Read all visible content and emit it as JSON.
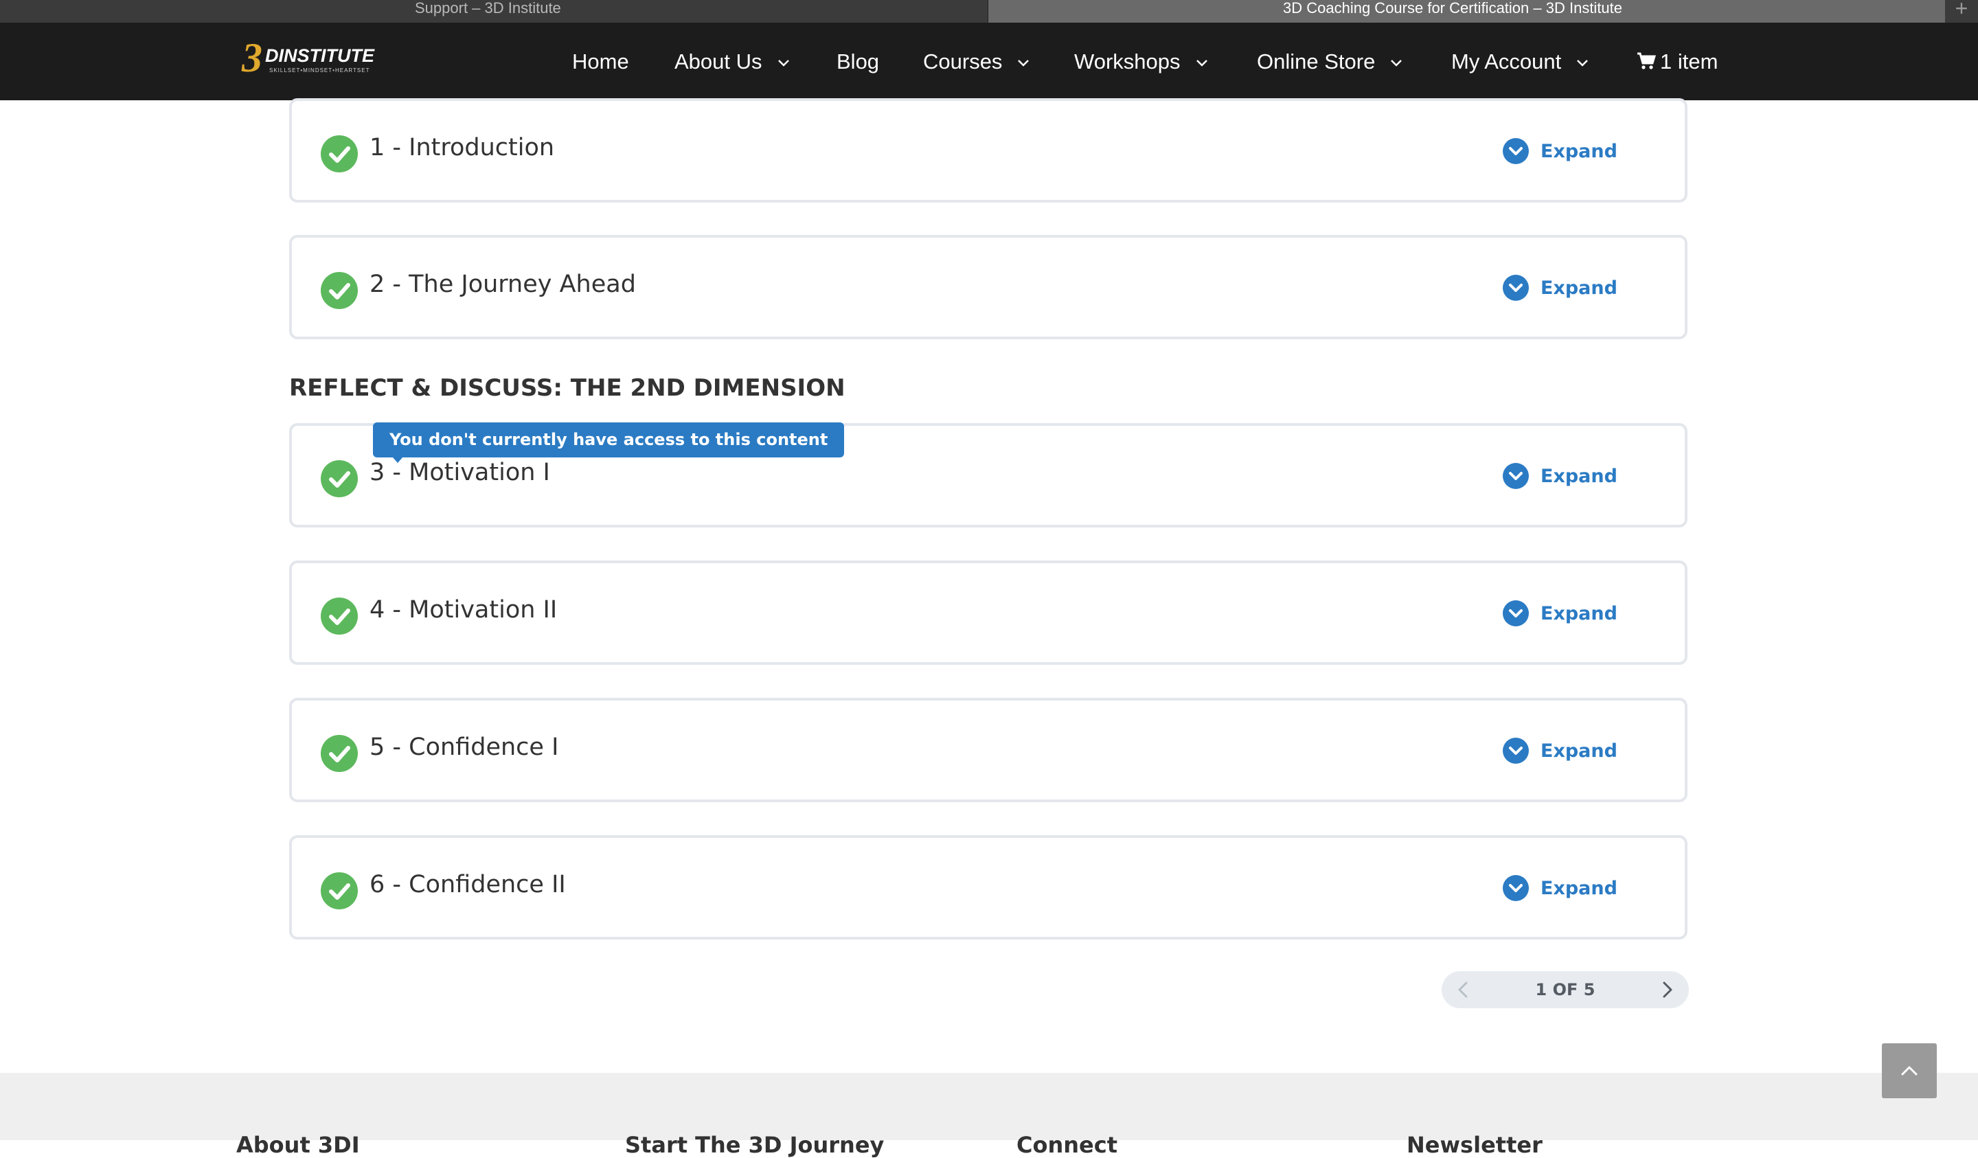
{
  "browser": {
    "tabs": [
      {
        "title": "Support – 3D Institute"
      },
      {
        "title": "3D Coaching Course for Certification – 3D Institute"
      }
    ],
    "new_tab_label": "+"
  },
  "site": {
    "logo": {
      "mark": "3",
      "word": "DINSTITUTE",
      "tagline": "SKILLSET•MINDSET•HEARTSET"
    },
    "nav": [
      {
        "label": "Home",
        "has_dropdown": false
      },
      {
        "label": "About Us",
        "has_dropdown": true
      },
      {
        "label": "Blog",
        "has_dropdown": false
      },
      {
        "label": "Courses",
        "has_dropdown": true
      },
      {
        "label": "Workshops",
        "has_dropdown": true
      },
      {
        "label": "Online Store",
        "has_dropdown": true
      },
      {
        "label": "My Account",
        "has_dropdown": true
      }
    ],
    "cart": {
      "label": "1 item",
      "icon": "cart-icon"
    }
  },
  "lessons": [
    {
      "title": "1 - Introduction",
      "status": "complete",
      "action": "Expand"
    },
    {
      "title": "2 - The Journey Ahead",
      "status": "complete",
      "action": "Expand"
    },
    {
      "title": "3 - Motivation I",
      "status": "complete",
      "action": "Expand"
    },
    {
      "title": "4 - Motivation II",
      "status": "complete",
      "action": "Expand"
    },
    {
      "title": "5 - Confidence I",
      "status": "complete",
      "action": "Expand"
    },
    {
      "title": "6 - Confidence II",
      "status": "complete",
      "action": "Expand"
    }
  ],
  "section_heading": "REFLECT & DISCUSS: THE 2ND DIMENSION",
  "tooltip": "You don't currently have access to this content",
  "pagination": {
    "label": "1 OF 5",
    "current": 1,
    "total": 5
  },
  "footer": {
    "headings": [
      "About 3DI",
      "Start The 3D Journey",
      "Connect",
      "Newsletter"
    ]
  },
  "colors": {
    "header_bg": "#1c1c1c",
    "accent_blue": "#2b7bc4",
    "check_green": "#5cb85c",
    "card_border": "#e3e7ec",
    "footer_bg": "#efefef"
  }
}
